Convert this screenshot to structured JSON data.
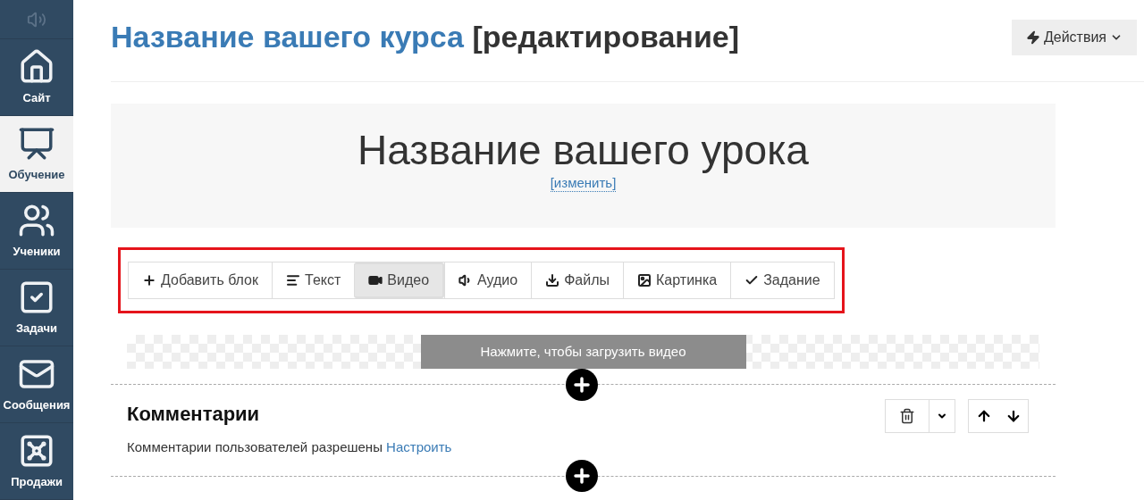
{
  "sidebar": {
    "items": [
      {
        "kind": "sound",
        "selected": false
      },
      {
        "kind": "home",
        "label": "Сайт",
        "selected": false
      },
      {
        "kind": "chart",
        "label": "Обучение",
        "selected": true
      },
      {
        "kind": "users",
        "label": "Ученики",
        "selected": false
      },
      {
        "kind": "task",
        "label": "Задачи",
        "selected": false
      },
      {
        "kind": "mail",
        "label": "Сообщения",
        "selected": false
      },
      {
        "kind": "safe",
        "label": "Продажи",
        "selected": false
      }
    ]
  },
  "header": {
    "title": "Название вашего курса",
    "suffix": "[редактирование]",
    "actions_button": "Действия"
  },
  "lesson": {
    "title": "Название вашего урока",
    "edit_link": "[изменить]"
  },
  "toolbar": {
    "highlighted": true,
    "buttons": [
      {
        "kind": "plus",
        "label": "Добавить блок",
        "selected": false
      },
      {
        "kind": "text",
        "label": "Текст",
        "selected": false
      },
      {
        "kind": "video",
        "label": "Видео",
        "selected": true
      },
      {
        "kind": "audio",
        "label": "Аудио",
        "selected": false
      },
      {
        "kind": "download",
        "label": "Файлы",
        "selected": false
      },
      {
        "kind": "image",
        "label": "Картинка",
        "selected": false
      },
      {
        "kind": "check",
        "label": "Задание",
        "selected": false
      }
    ]
  },
  "video_block": {
    "upload_button": "Нажмите, чтобы загрузить видео"
  },
  "comments": {
    "title": "Комментарии",
    "text": "Комментарии пользователей разрешены",
    "link": "Настроить"
  }
}
